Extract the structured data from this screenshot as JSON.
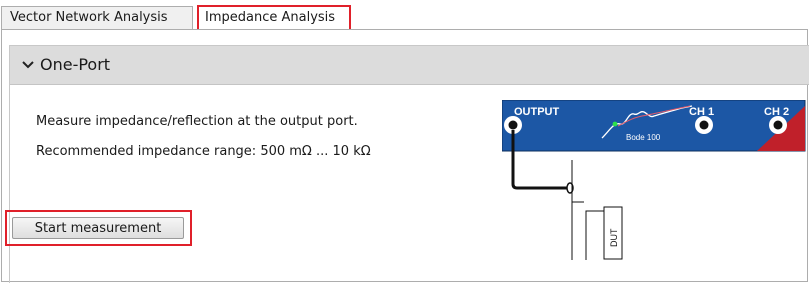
{
  "tabs": [
    {
      "label": "Vector Network Analysis",
      "active": false
    },
    {
      "label": "Impedance Analysis",
      "active": true
    }
  ],
  "section": {
    "title": "One-Port",
    "expanded": true,
    "description": "Measure impedance/reflection at the output port.",
    "range": "Recommended impedance range: 500 mΩ ... 10 kΩ"
  },
  "device": {
    "output_label": "OUTPUT",
    "ch1_label": "CH 1",
    "ch2_label": "CH 2",
    "model": "Bode 100",
    "dut_label": "DUT",
    "colors": {
      "body": "#1c57a5",
      "accent": "#c0202a",
      "connector": "#ffffff"
    }
  },
  "actions": {
    "start_label": "Start measurement"
  },
  "colors": {
    "highlight": "#e0202a",
    "header_bg": "#dcdcdc"
  }
}
